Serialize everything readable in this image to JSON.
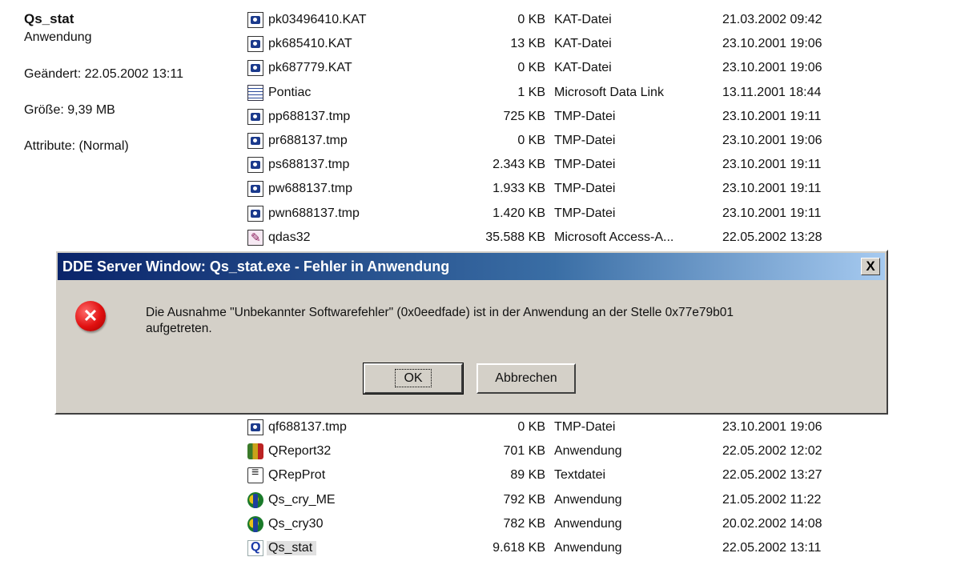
{
  "details": {
    "name": "Qs_stat",
    "type": "Anwendung",
    "modified": "Geändert: 22.05.2002 13:11",
    "size": "Größe: 9,39 MB",
    "attributes": "Attribute: (Normal)"
  },
  "files_top": [
    {
      "name": "pk03496410.KAT",
      "size": "0 KB",
      "type": "KAT-Datei",
      "date": "21.03.2002 09:42",
      "icon": "kat-file-icon"
    },
    {
      "name": "pk685410.KAT",
      "size": "13 KB",
      "type": "KAT-Datei",
      "date": "23.10.2001 19:06",
      "icon": "kat-file-icon"
    },
    {
      "name": "pk687779.KAT",
      "size": "0 KB",
      "type": "KAT-Datei",
      "date": "23.10.2001 19:06",
      "icon": "kat-file-icon"
    },
    {
      "name": "Pontiac",
      "size": "1 KB",
      "type": "Microsoft Data Link",
      "date": "13.11.2001 18:44",
      "icon": "data-link-icon"
    },
    {
      "name": "pp688137.tmp",
      "size": "725 KB",
      "type": "TMP-Datei",
      "date": "23.10.2001 19:11",
      "icon": "tmp-file-icon"
    },
    {
      "name": "pr688137.tmp",
      "size": "0 KB",
      "type": "TMP-Datei",
      "date": "23.10.2001 19:06",
      "icon": "tmp-file-icon"
    },
    {
      "name": "ps688137.tmp",
      "size": "2.343 KB",
      "type": "TMP-Datei",
      "date": "23.10.2001 19:11",
      "icon": "tmp-file-icon"
    },
    {
      "name": "pw688137.tmp",
      "size": "1.933 KB",
      "type": "TMP-Datei",
      "date": "23.10.2001 19:11",
      "icon": "tmp-file-icon"
    },
    {
      "name": "pwn688137.tmp",
      "size": "1.420 KB",
      "type": "TMP-Datei",
      "date": "23.10.2001 19:11",
      "icon": "tmp-file-icon"
    },
    {
      "name": "qdas32",
      "size": "35.588 KB",
      "type": "Microsoft Access-A...",
      "date": "22.05.2002 13:28",
      "icon": "access-file-icon"
    }
  ],
  "files_bottom": [
    {
      "name": "qf688137.tmp",
      "size": "0 KB",
      "type": "TMP-Datei",
      "date": "23.10.2001 19:06",
      "icon": "tmp-file-icon"
    },
    {
      "name": "QReport32",
      "size": "701 KB",
      "type": "Anwendung",
      "date": "22.05.2002 12:02",
      "icon": "qreport-app-icon"
    },
    {
      "name": "QRepProt",
      "size": "89 KB",
      "type": "Textdatei",
      "date": "22.05.2002 13:27",
      "icon": "text-file-icon"
    },
    {
      "name": "Qs_cry_ME",
      "size": "792 KB",
      "type": "Anwendung",
      "date": "21.05.2002 11:22",
      "icon": "crystal-app-icon"
    },
    {
      "name": "Qs_cry30",
      "size": "782 KB",
      "type": "Anwendung",
      "date": "20.02.2002 14:08",
      "icon": "crystal-app-icon"
    },
    {
      "name": "Qs_stat",
      "size": "9.618 KB",
      "type": "Anwendung",
      "date": "22.05.2002 13:11",
      "icon": "qs-stat-app-icon",
      "selected": true
    }
  ],
  "dialog": {
    "title": "DDE Server Window: Qs_stat.exe - Fehler in Anwendung",
    "close_label": "X",
    "message_line1": "Die Ausnahme \"Unbekannter Softwarefehler\" (0x0eedfade) ist in der Anwendung an der Stelle 0x77e79b01",
    "message_line2": "aufgetreten.",
    "ok_label": "OK",
    "cancel_label": "Abbrechen",
    "icon": "error-icon"
  }
}
